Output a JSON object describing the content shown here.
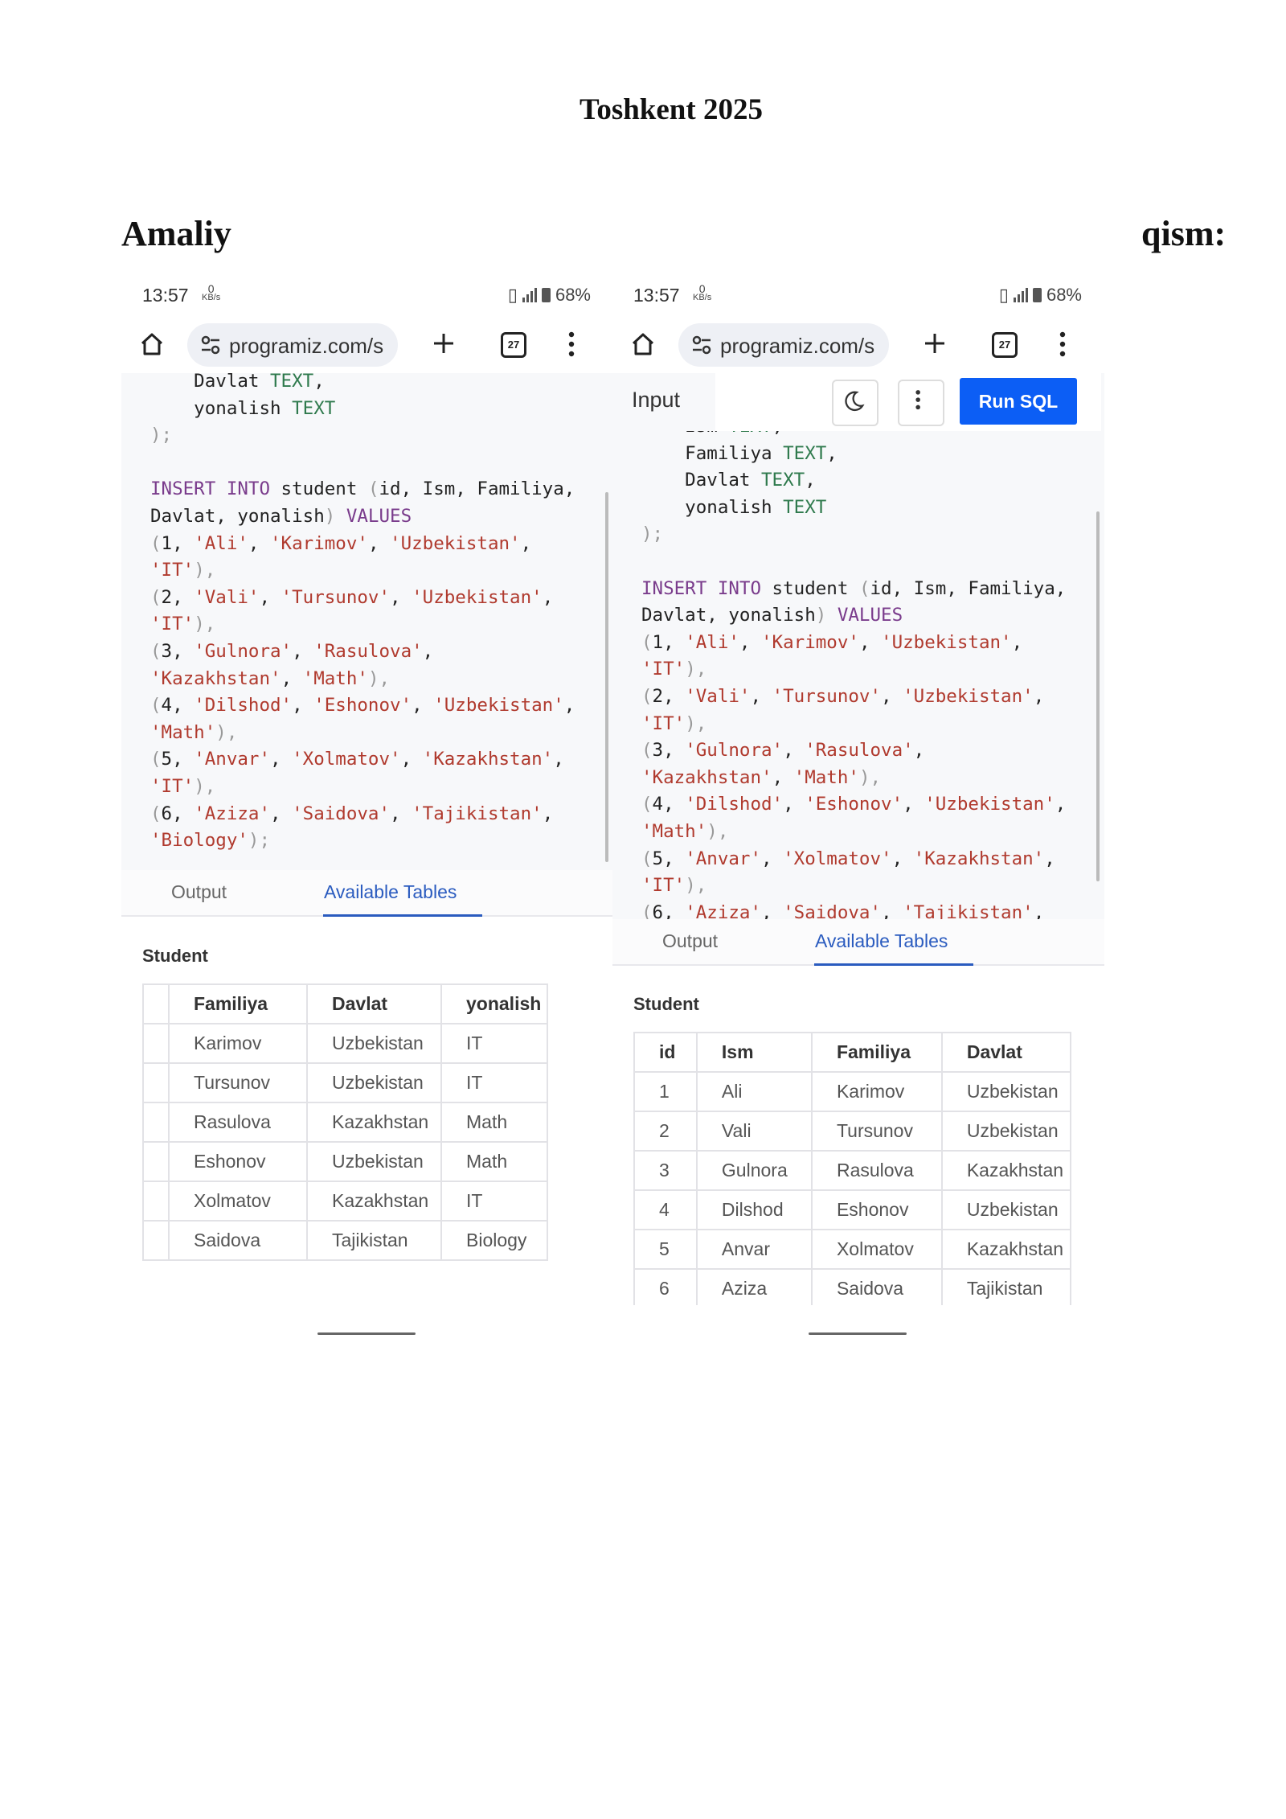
{
  "document": {
    "title": "Toshkent 2025",
    "heading_left": "Amaliy",
    "heading_right": "qism:"
  },
  "status_bar": {
    "time": "13:57",
    "kbs_value": "0",
    "kbs_unit": "KB/s",
    "battery": "68%"
  },
  "browser": {
    "url": "programiz.com/s",
    "tab_count": "27"
  },
  "left_screen": {
    "code_lines": [
      [
        {
          "t": "    Davlat ",
          "c": ""
        },
        {
          "t": "TEXT",
          "c": "ty"
        },
        {
          "t": ",",
          "c": ""
        }
      ],
      [
        {
          "t": "    yonalish ",
          "c": ""
        },
        {
          "t": "TEXT",
          "c": "ty"
        }
      ],
      [
        {
          "t": ");",
          "c": "pu"
        }
      ],
      [
        {
          "t": "",
          "c": ""
        }
      ],
      [
        {
          "t": "INSERT INTO",
          "c": "kw"
        },
        {
          "t": " student ",
          "c": ""
        },
        {
          "t": "(",
          "c": "pu"
        },
        {
          "t": "id, Ism, Familiya,",
          "c": ""
        }
      ],
      [
        {
          "t": "Davlat, yonalish",
          "c": ""
        },
        {
          "t": ")",
          "c": "pu"
        },
        {
          "t": " VALUES",
          "c": "kw"
        }
      ],
      [
        {
          "t": "(",
          "c": "pu"
        },
        {
          "t": "1, ",
          "c": ""
        },
        {
          "t": "'Ali'",
          "c": "st"
        },
        {
          "t": ", ",
          "c": ""
        },
        {
          "t": "'Karimov'",
          "c": "st"
        },
        {
          "t": ", ",
          "c": ""
        },
        {
          "t": "'Uzbekistan'",
          "c": "st"
        },
        {
          "t": ",",
          "c": ""
        }
      ],
      [
        {
          "t": "'IT'",
          "c": "st"
        },
        {
          "t": "),",
          "c": "pu"
        }
      ],
      [
        {
          "t": "(",
          "c": "pu"
        },
        {
          "t": "2, ",
          "c": ""
        },
        {
          "t": "'Vali'",
          "c": "st"
        },
        {
          "t": ", ",
          "c": ""
        },
        {
          "t": "'Tursunov'",
          "c": "st"
        },
        {
          "t": ", ",
          "c": ""
        },
        {
          "t": "'Uzbekistan'",
          "c": "st"
        },
        {
          "t": ",",
          "c": ""
        }
      ],
      [
        {
          "t": "'IT'",
          "c": "st"
        },
        {
          "t": "),",
          "c": "pu"
        }
      ],
      [
        {
          "t": "(",
          "c": "pu"
        },
        {
          "t": "3, ",
          "c": ""
        },
        {
          "t": "'Gulnora'",
          "c": "st"
        },
        {
          "t": ", ",
          "c": ""
        },
        {
          "t": "'Rasulova'",
          "c": "st"
        },
        {
          "t": ",",
          "c": ""
        }
      ],
      [
        {
          "t": "'Kazakhstan'",
          "c": "st"
        },
        {
          "t": ", ",
          "c": ""
        },
        {
          "t": "'Math'",
          "c": "st"
        },
        {
          "t": "),",
          "c": "pu"
        }
      ],
      [
        {
          "t": "(",
          "c": "pu"
        },
        {
          "t": "4, ",
          "c": ""
        },
        {
          "t": "'Dilshod'",
          "c": "st"
        },
        {
          "t": ", ",
          "c": ""
        },
        {
          "t": "'Eshonov'",
          "c": "st"
        },
        {
          "t": ", ",
          "c": ""
        },
        {
          "t": "'Uzbekistan'",
          "c": "st"
        },
        {
          "t": ",",
          "c": ""
        }
      ],
      [
        {
          "t": "'Math'",
          "c": "st"
        },
        {
          "t": "),",
          "c": "pu"
        }
      ],
      [
        {
          "t": "(",
          "c": "pu"
        },
        {
          "t": "5, ",
          "c": ""
        },
        {
          "t": "'Anvar'",
          "c": "st"
        },
        {
          "t": ", ",
          "c": ""
        },
        {
          "t": "'Xolmatov'",
          "c": "st"
        },
        {
          "t": ", ",
          "c": ""
        },
        {
          "t": "'Kazakhstan'",
          "c": "st"
        },
        {
          "t": ",",
          "c": ""
        }
      ],
      [
        {
          "t": "'IT'",
          "c": "st"
        },
        {
          "t": "),",
          "c": "pu"
        }
      ],
      [
        {
          "t": "(",
          "c": "pu"
        },
        {
          "t": "6, ",
          "c": ""
        },
        {
          "t": "'Aziza'",
          "c": "st"
        },
        {
          "t": ", ",
          "c": ""
        },
        {
          "t": "'Saidova'",
          "c": "st"
        },
        {
          "t": ", ",
          "c": ""
        },
        {
          "t": "'Tajikistan'",
          "c": "st"
        },
        {
          "t": ",",
          "c": ""
        }
      ],
      [
        {
          "t": "'Biology'",
          "c": "st"
        },
        {
          "t": ");",
          "c": "pu"
        }
      ]
    ],
    "tab_output": "Output",
    "tab_available": "Available Tables",
    "table_title": "Student",
    "table": {
      "headers": [
        "",
        "Familiya",
        "Davlat",
        "yonalish"
      ],
      "rows": [
        [
          "",
          "Karimov",
          "Uzbekistan",
          "IT"
        ],
        [
          "",
          "Tursunov",
          "Uzbekistan",
          "IT"
        ],
        [
          "",
          "Rasulova",
          "Kazakhstan",
          "Math"
        ],
        [
          "",
          "Eshonov",
          "Uzbekistan",
          "Math"
        ],
        [
          "",
          "Xolmatov",
          "Kazakhstan",
          "IT"
        ],
        [
          "",
          "Saidova",
          "Tajikistan",
          "Biology"
        ]
      ]
    }
  },
  "right_screen": {
    "input_label": "Input",
    "run_button": "Run SQL",
    "code_lines": [
      [
        {
          "t": "    Ism ",
          "c": ""
        },
        {
          "t": "TEXT",
          "c": "ty"
        },
        {
          "t": ",",
          "c": ""
        }
      ],
      [
        {
          "t": "    Familiya ",
          "c": ""
        },
        {
          "t": "TEXT",
          "c": "ty"
        },
        {
          "t": ",",
          "c": ""
        }
      ],
      [
        {
          "t": "    Davlat ",
          "c": ""
        },
        {
          "t": "TEXT",
          "c": "ty"
        },
        {
          "t": ",",
          "c": ""
        }
      ],
      [
        {
          "t": "    yonalish ",
          "c": ""
        },
        {
          "t": "TEXT",
          "c": "ty"
        }
      ],
      [
        {
          "t": ");",
          "c": "pu"
        }
      ],
      [
        {
          "t": "",
          "c": ""
        }
      ],
      [
        {
          "t": "INSERT INTO",
          "c": "kw"
        },
        {
          "t": " student ",
          "c": ""
        },
        {
          "t": "(",
          "c": "pu"
        },
        {
          "t": "id, Ism, Familiya,",
          "c": ""
        }
      ],
      [
        {
          "t": "Davlat, yonalish",
          "c": ""
        },
        {
          "t": ")",
          "c": "pu"
        },
        {
          "t": " VALUES",
          "c": "kw"
        }
      ],
      [
        {
          "t": "(",
          "c": "pu"
        },
        {
          "t": "1, ",
          "c": ""
        },
        {
          "t": "'Ali'",
          "c": "st"
        },
        {
          "t": ", ",
          "c": ""
        },
        {
          "t": "'Karimov'",
          "c": "st"
        },
        {
          "t": ", ",
          "c": ""
        },
        {
          "t": "'Uzbekistan'",
          "c": "st"
        },
        {
          "t": ",",
          "c": ""
        }
      ],
      [
        {
          "t": "'IT'",
          "c": "st"
        },
        {
          "t": "),",
          "c": "pu"
        }
      ],
      [
        {
          "t": "(",
          "c": "pu"
        },
        {
          "t": "2, ",
          "c": ""
        },
        {
          "t": "'Vali'",
          "c": "st"
        },
        {
          "t": ", ",
          "c": ""
        },
        {
          "t": "'Tursunov'",
          "c": "st"
        },
        {
          "t": ", ",
          "c": ""
        },
        {
          "t": "'Uzbekistan'",
          "c": "st"
        },
        {
          "t": ",",
          "c": ""
        }
      ],
      [
        {
          "t": "'IT'",
          "c": "st"
        },
        {
          "t": "),",
          "c": "pu"
        }
      ],
      [
        {
          "t": "(",
          "c": "pu"
        },
        {
          "t": "3, ",
          "c": ""
        },
        {
          "t": "'Gulnora'",
          "c": "st"
        },
        {
          "t": ", ",
          "c": ""
        },
        {
          "t": "'Rasulova'",
          "c": "st"
        },
        {
          "t": ",",
          "c": ""
        }
      ],
      [
        {
          "t": "'Kazakhstan'",
          "c": "st"
        },
        {
          "t": ", ",
          "c": ""
        },
        {
          "t": "'Math'",
          "c": "st"
        },
        {
          "t": "),",
          "c": "pu"
        }
      ],
      [
        {
          "t": "(",
          "c": "pu"
        },
        {
          "t": "4, ",
          "c": ""
        },
        {
          "t": "'Dilshod'",
          "c": "st"
        },
        {
          "t": ", ",
          "c": ""
        },
        {
          "t": "'Eshonov'",
          "c": "st"
        },
        {
          "t": ", ",
          "c": ""
        },
        {
          "t": "'Uzbekistan'",
          "c": "st"
        },
        {
          "t": ",",
          "c": ""
        }
      ],
      [
        {
          "t": "'Math'",
          "c": "st"
        },
        {
          "t": "),",
          "c": "pu"
        }
      ],
      [
        {
          "t": "(",
          "c": "pu"
        },
        {
          "t": "5, ",
          "c": ""
        },
        {
          "t": "'Anvar'",
          "c": "st"
        },
        {
          "t": ", ",
          "c": ""
        },
        {
          "t": "'Xolmatov'",
          "c": "st"
        },
        {
          "t": ", ",
          "c": ""
        },
        {
          "t": "'Kazakhstan'",
          "c": "st"
        },
        {
          "t": ",",
          "c": ""
        }
      ],
      [
        {
          "t": "'IT'",
          "c": "st"
        },
        {
          "t": "),",
          "c": "pu"
        }
      ],
      [
        {
          "t": "(",
          "c": "pu"
        },
        {
          "t": "6, ",
          "c": ""
        },
        {
          "t": "'Aziza'",
          "c": "st"
        },
        {
          "t": ", ",
          "c": ""
        },
        {
          "t": "'Saidova'",
          "c": "st"
        },
        {
          "t": ", ",
          "c": ""
        },
        {
          "t": "'Tajikistan'",
          "c": "st"
        },
        {
          "t": ",",
          "c": ""
        }
      ]
    ],
    "tab_output": "Output",
    "tab_available": "Available Tables",
    "table_title": "Student",
    "table": {
      "headers": [
        "id",
        "Ism",
        "Familiya",
        "Davlat"
      ],
      "rows": [
        [
          "1",
          "Ali",
          "Karimov",
          "Uzbekistan"
        ],
        [
          "2",
          "Vali",
          "Tursunov",
          "Uzbekistan"
        ],
        [
          "3",
          "Gulnora",
          "Rasulova",
          "Kazakhstan"
        ],
        [
          "4",
          "Dilshod",
          "Eshonov",
          "Uzbekistan"
        ],
        [
          "5",
          "Anvar",
          "Xolmatov",
          "Kazakhstan"
        ],
        [
          "6",
          "Aziza",
          "Saidova",
          "Tajikistan"
        ]
      ]
    }
  },
  "colors": {
    "accent_blue": "#0c5ef5",
    "tab_active": "#2a5bbf",
    "sql_keyword": "#7a3c8c",
    "sql_type": "#2f7a4d",
    "sql_string": "#b03a2e"
  }
}
